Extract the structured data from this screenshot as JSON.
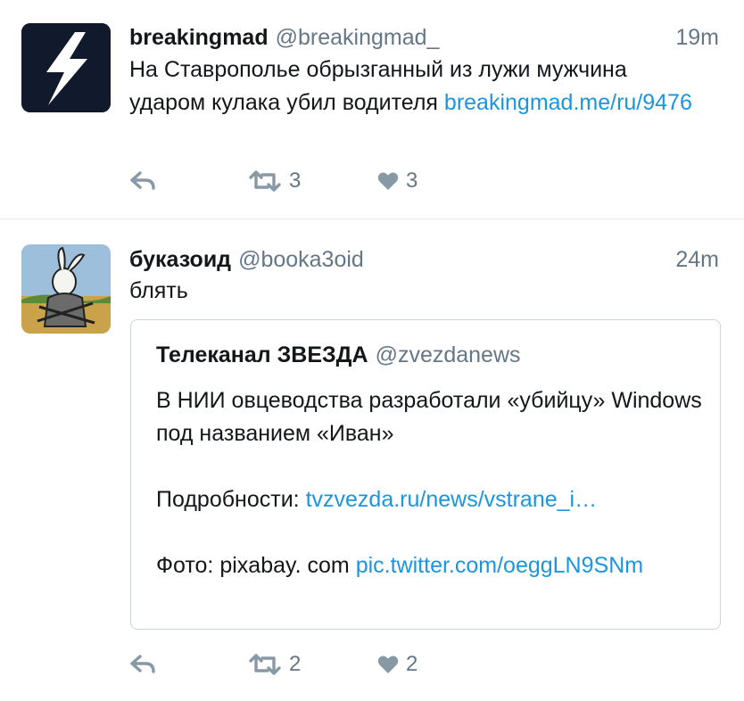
{
  "tweets": [
    {
      "name": "breakingmad",
      "handle": "@breakingmad_",
      "time": "19m",
      "text": "На Ставрополье обрызганный из лужи мужчина ударом кулака убил водителя ",
      "link": "breakingmad.me/ru/9476",
      "retweets": "3",
      "likes": "3"
    },
    {
      "name": "буказоид",
      "handle": "@booka3oid",
      "time": "24m",
      "text": "блять",
      "retweets": "2",
      "likes": "2",
      "quote": {
        "name": "Телеканал ЗВЕЗДА",
        "handle": "@zvezdanews",
        "line1": "В НИИ овцеводства разработали «убийцу» Windows под названием «Иван»",
        "details_label": "Подробности: ",
        "details_link": "tvzvezda.ru/news/vstrane_i…",
        "photo_label": "Фото: pixabay. com ",
        "photo_link": "pic.twitter.com/oeggLN9SNm"
      }
    }
  ],
  "icons": {
    "reply": "reply-icon",
    "retweet": "retweet-icon",
    "like": "heart-icon",
    "avatar1": "lightning-bolt-avatar",
    "avatar2": "rabbit-samurai-avatar"
  },
  "colors": {
    "link": "#1b95e0",
    "muted": "#657786",
    "icon": "#8899a6",
    "border": "#ccd6dd"
  }
}
